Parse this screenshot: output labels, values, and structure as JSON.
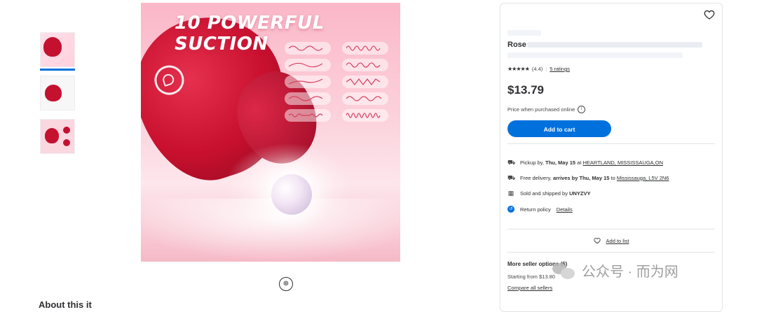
{
  "hero": {
    "title": "10 POWERFUL SUCTION"
  },
  "about": {
    "label": "About this it"
  },
  "product": {
    "title_visible": "Rose",
    "rating_value": "(4.4)",
    "rating_link": "5 ratings",
    "price": "$13.79",
    "price_note": "Price when purchased online",
    "add_to_cart": "Add to cart"
  },
  "fulfillment": {
    "pickup": {
      "prefix": "Pickup by, ",
      "date": "Thu, May 15",
      "mid": " at ",
      "store": "HEARTLAND, MISSISSAUGA,ON"
    },
    "delivery": {
      "prefix": "Free delivery, ",
      "arrives": "arrives by Thu, May 15",
      "mid": " to ",
      "location": "Mississauga, L5V 2N6"
    },
    "seller": {
      "prefix": "Sold and shipped by ",
      "name": "UNYZVY"
    },
    "returns": {
      "label": "Return policy",
      "link": "Details"
    }
  },
  "add_to_list": "Add to list",
  "more_sellers": {
    "title": "More seller options (6)",
    "from": "Starting from $13.80",
    "compare": "Compare all sellers"
  },
  "watermark": {
    "text": "公众号 · 而为网"
  },
  "colors": {
    "accent": "#0071dc",
    "rose": "#c8102e"
  }
}
